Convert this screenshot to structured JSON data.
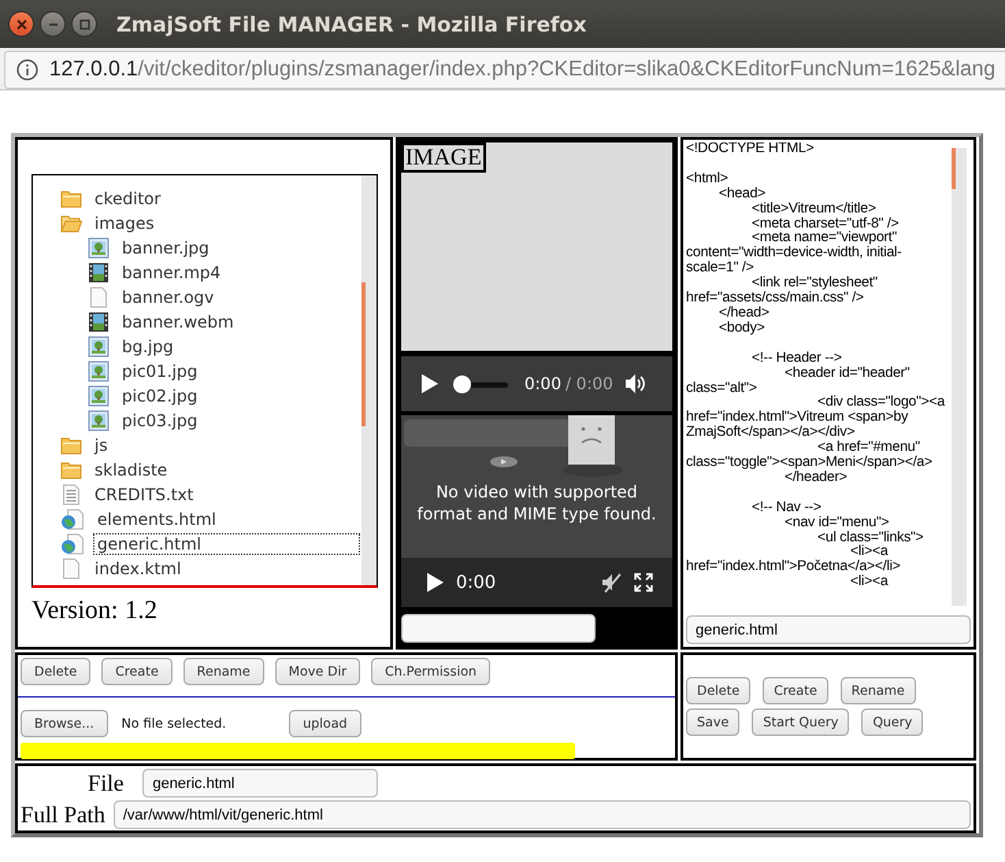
{
  "window": {
    "title": "ZmajSoft File MANAGER - Mozilla Firefox"
  },
  "address_bar": {
    "host": "127.0.0.1",
    "path": "/vit/ckeditor/plugins/zsmanager/index.php?CKEditor=slika0&CKEditorFuncNum=1625&lang"
  },
  "file_tree": {
    "items": [
      {
        "name": "ckeditor",
        "kind": "folder",
        "expanded": false,
        "selected": false
      },
      {
        "name": "images",
        "kind": "folder",
        "expanded": true,
        "selected": false,
        "children": [
          {
            "name": "banner.jpg",
            "kind": "image",
            "selected": false
          },
          {
            "name": "banner.mp4",
            "kind": "video",
            "selected": false
          },
          {
            "name": "banner.ogv",
            "kind": "file",
            "selected": false
          },
          {
            "name": "banner.webm",
            "kind": "video",
            "selected": false
          },
          {
            "name": "bg.jpg",
            "kind": "image",
            "selected": false
          },
          {
            "name": "pic01.jpg",
            "kind": "image",
            "selected": false
          },
          {
            "name": "pic02.jpg",
            "kind": "image",
            "selected": false
          },
          {
            "name": "pic03.jpg",
            "kind": "image",
            "selected": false
          }
        ]
      },
      {
        "name": "js",
        "kind": "folder",
        "expanded": false,
        "selected": false
      },
      {
        "name": "skladiste",
        "kind": "folder",
        "expanded": false,
        "selected": false
      },
      {
        "name": "CREDITS.txt",
        "kind": "text",
        "selected": false
      },
      {
        "name": "elements.html",
        "kind": "html",
        "selected": false
      },
      {
        "name": "generic.html",
        "kind": "html",
        "selected": true
      },
      {
        "name": "index.ktml",
        "kind": "file",
        "selected": false
      }
    ],
    "version": "Version: 1.2"
  },
  "preview": {
    "image_label": "IMAGE",
    "audio": {
      "time": "0:00",
      "duration": "/ 0:00",
      "level": 0
    },
    "video": {
      "message": "No video with supported format and MIME type found.",
      "time": "0:00"
    }
  },
  "editor": {
    "code": "<!DOCTYPE HTML>\n\n<html>\n\t<head>\n\t\t<title>Vitreum</title>\n\t\t<meta charset=\"utf-8\" />\n\t\t<meta name=\"viewport\" content=\"width=device-width, initial-scale=1\" />\n\t\t<link rel=\"stylesheet\" href=\"assets/css/main.css\" />\n\t</head>\n\t<body>\n\n\t\t<!-- Header -->\n\t\t\t<header id=\"header\" class=\"alt\">\n\t\t\t\t<div class=\"logo\"><a href=\"index.html\">Vitreum <span>by ZmajSoft</span></a></div>\n\t\t\t\t<a href=\"#menu\" class=\"toggle\"><span>Meni</span></a>\n\t\t\t</header>\n\n\t\t<!-- Nav -->\n\t\t\t<nav id=\"menu\">\n\t\t\t\t<ul class=\"links\">\n\t\t\t\t\t<li><a href=\"index.html\">Početna</a></li>\n\t\t\t\t\t<li><a",
    "filename": "generic.html"
  },
  "file_actions": [
    "Delete",
    "Create",
    "Rename",
    "Move Dir",
    "Ch.Permission"
  ],
  "upload": {
    "browse": "Browse...",
    "status": "No file selected.",
    "button": "upload",
    "level": 1
  },
  "query_actions": [
    [
      "Delete",
      "Create",
      "Rename"
    ],
    [
      "Save",
      "Start Query",
      "Query"
    ]
  ],
  "file_field": {
    "label": "File",
    "value": "generic.html"
  },
  "path_field": {
    "label": "Full Path",
    "value": "/var/www/html/vit/generic.html"
  }
}
